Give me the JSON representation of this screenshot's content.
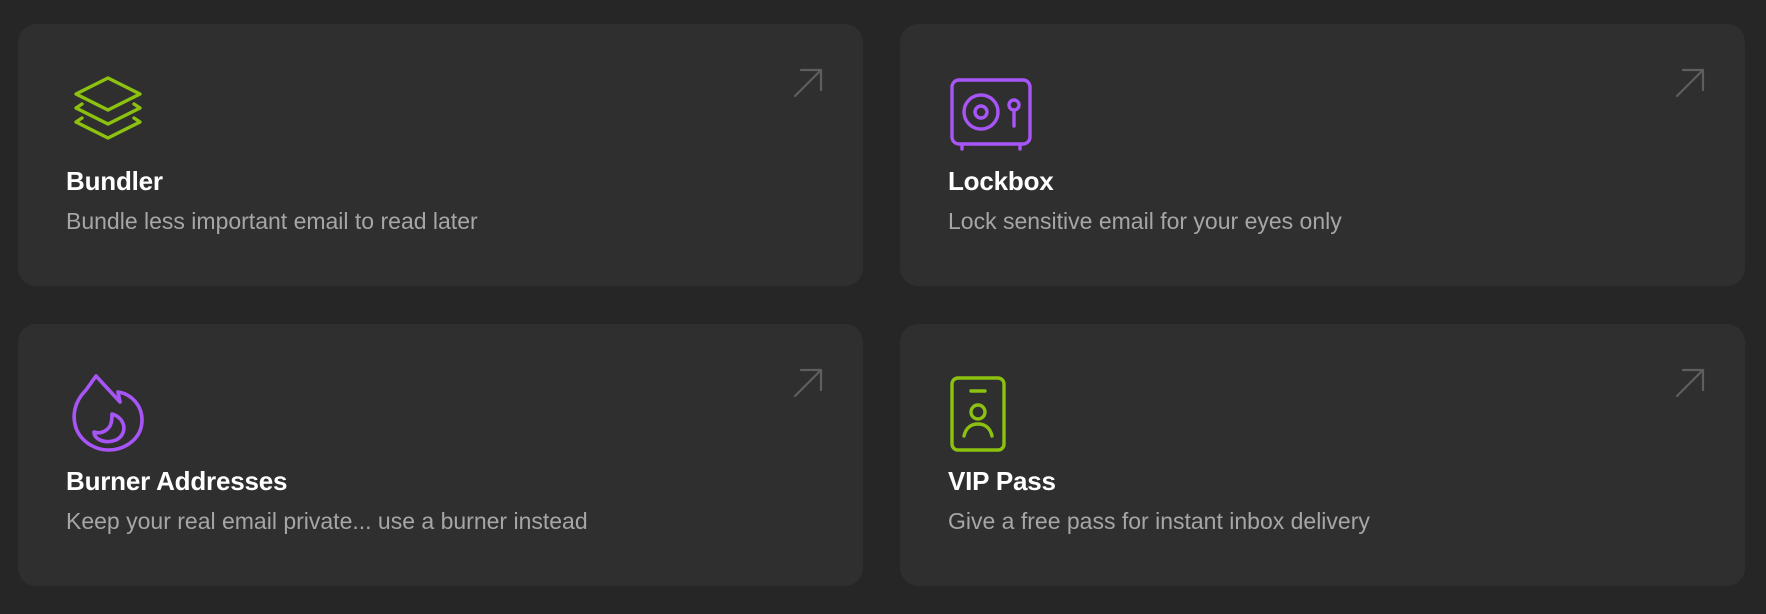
{
  "colors": {
    "background": "#262626",
    "card": "#2f2f2f",
    "title": "#ffffff",
    "description": "#a6a6a6",
    "arrow": "#5e5e5e",
    "green_accent": "#8cc20f",
    "purple_accent": "#a855f7"
  },
  "features": [
    {
      "title": "Bundler",
      "description": "Bundle less important email to read later",
      "icon": "layers-icon",
      "icon_color": "#8cc20f"
    },
    {
      "title": "Lockbox",
      "description": "Lock sensitive email for your eyes only",
      "icon": "safe-icon",
      "icon_color": "#a855f7"
    },
    {
      "title": "Burner Addresses",
      "description": "Keep your real email private... use a burner instead",
      "icon": "flame-icon",
      "icon_color": "#a855f7"
    },
    {
      "title": "VIP Pass",
      "description": "Give a free pass for instant inbox delivery",
      "icon": "id-badge-icon",
      "icon_color": "#8cc20f"
    }
  ]
}
